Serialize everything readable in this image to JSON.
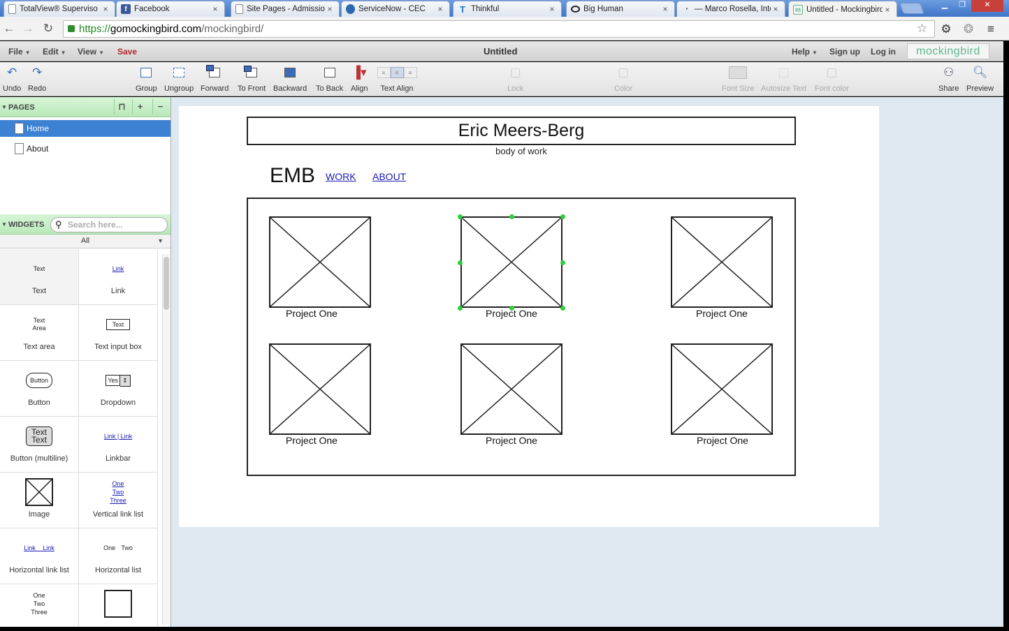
{
  "browser": {
    "tabs": [
      {
        "title": "TotalView® Superviso",
        "fav": "doc"
      },
      {
        "title": "Facebook",
        "fav": "f"
      },
      {
        "title": "Site Pages - Admissio",
        "fav": "doc"
      },
      {
        "title": "ServiceNow - CEC",
        "fav": "sn"
      },
      {
        "title": "Thinkful",
        "fav": "T"
      },
      {
        "title": "Big Human",
        "fav": "eye"
      },
      {
        "title": "— Marco Rosella, Inte",
        "fav": "rss"
      },
      {
        "title": "Untitled - Mockingbird",
        "fav": "m"
      }
    ],
    "close_glyph": "×",
    "url": {
      "scheme": "https://",
      "domain": "gomockingbird.com",
      "path": "/mockingbird/"
    }
  },
  "menu": {
    "file": "File",
    "edit": "Edit",
    "view": "View",
    "save": "Save",
    "title": "Untitled",
    "help": "Help",
    "signup": "Sign up",
    "login": "Log in",
    "brand": "mockingbird"
  },
  "toolbar": {
    "undo": "Undo",
    "redo": "Redo",
    "group": "Group",
    "ungroup": "Ungroup",
    "forward": "Forward",
    "tofront": "To Front",
    "backward": "Backward",
    "toback": "To Back",
    "align": "Align",
    "textalign": "Text Align",
    "lock": "Lock",
    "color": "Color",
    "fontsize": "Font Size",
    "autosize": "Autosize Text",
    "fontcolor": "Font color",
    "share": "Share",
    "preview": "Preview"
  },
  "sidebar": {
    "pages_title": "PAGES",
    "pages": [
      {
        "label": "Home",
        "selected": true
      },
      {
        "label": "About",
        "selected": false
      }
    ],
    "widgets_title": "WIDGETS",
    "search_placeholder": "Search here...",
    "filter": "All",
    "widgets": [
      {
        "label": "Text",
        "preview": "Text"
      },
      {
        "label": "Link",
        "preview": "Link"
      },
      {
        "label": "Text area",
        "preview": "Text Area"
      },
      {
        "label": "Text input box",
        "preview": "Text"
      },
      {
        "label": "Button",
        "preview": "Button"
      },
      {
        "label": "Dropdown",
        "preview": "Yes"
      },
      {
        "label": "Button (multiline)",
        "preview": "Text Text"
      },
      {
        "label": "Linkbar",
        "preview": "Link | Link"
      },
      {
        "label": "Image",
        "preview": ""
      },
      {
        "label": "Vertical link list",
        "preview": "One Two Three"
      },
      {
        "label": "Horizontal link list",
        "preview": "Link Link"
      },
      {
        "label": "Horizontal list",
        "preview": "One Two"
      },
      {
        "label": "",
        "preview": "One Two Three"
      },
      {
        "label": "",
        "preview": ""
      }
    ]
  },
  "canvas": {
    "title": "Eric Meers-Berg",
    "subtitle": "body of work",
    "logo": "EMB",
    "links": [
      "WORK",
      "ABOUT"
    ],
    "projects": [
      {
        "caption": "Project One",
        "selected": false
      },
      {
        "caption": "Project One",
        "selected": true
      },
      {
        "caption": "Project One",
        "selected": false
      },
      {
        "caption": "Project One",
        "selected": false
      },
      {
        "caption": "Project One",
        "selected": false
      },
      {
        "caption": "Project One",
        "selected": false
      }
    ],
    "selection_color": "#2fcf3a"
  }
}
